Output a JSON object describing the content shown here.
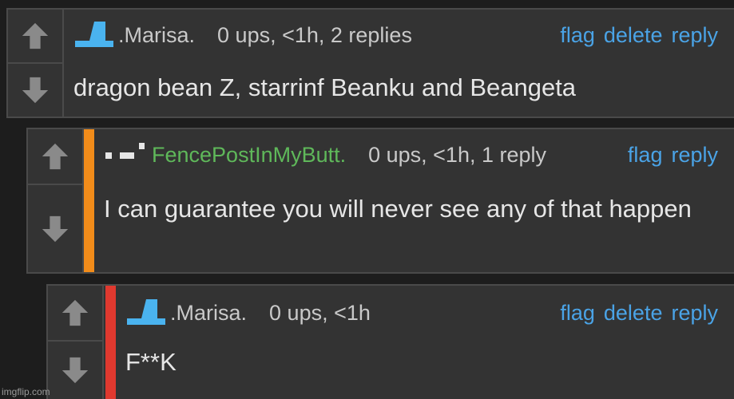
{
  "comments": [
    {
      "username": ".Marisa.",
      "meta": "0 ups, <1h, 2 replies",
      "actions": [
        "flag",
        "delete",
        "reply"
      ],
      "text": "dragon bean Z, starrinf Beanku and Beangeta"
    },
    {
      "username": "FencePostInMyButt.",
      "meta": "0 ups, <1h, 1 reply",
      "actions": [
        "flag",
        "reply"
      ],
      "text": "I can guarantee you will never see any of that happen"
    },
    {
      "username": ".Marisa.",
      "meta": "0 ups, <1h",
      "actions": [
        "flag",
        "delete",
        "reply"
      ],
      "text": "F**K"
    }
  ],
  "watermark": "imgflip.com",
  "colors": {
    "link": "#4aa3e6",
    "reply1_stripe": "#f28c1a",
    "reply2_stripe": "#e0392f",
    "username_green": "#5fb85a",
    "avatar_blue": "#4ab3ef"
  },
  "icons": {
    "upvote": "up-arrow-icon",
    "downvote": "down-arrow-icon"
  }
}
